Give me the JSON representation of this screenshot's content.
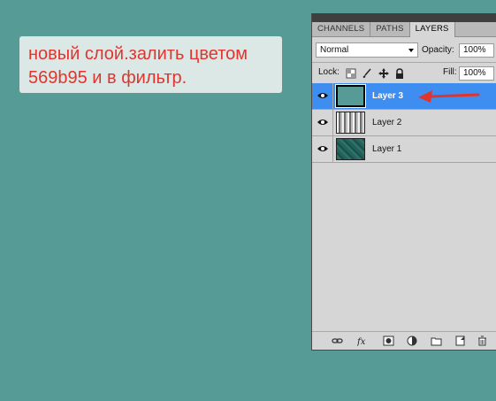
{
  "note": {
    "line1": "новый слой.залить цветом",
    "line2": "569b95 и в фильтр."
  },
  "tabs": [
    {
      "label": "CHANNELS"
    },
    {
      "label": "PATHS"
    },
    {
      "label": "LAYERS"
    }
  ],
  "blend_mode": "Normal",
  "opacity_label": "Opacity:",
  "opacity_value": "100%",
  "lock_label": "Lock:",
  "fill_label": "Fill:",
  "fill_value": "100%",
  "layers": [
    {
      "name": "Layer 3",
      "selected": true
    },
    {
      "name": "Layer 2",
      "selected": false
    },
    {
      "name": "Layer 1",
      "selected": false
    }
  ],
  "colors": {
    "canvas": "#569b95",
    "note_text": "#e0352e",
    "selection": "#3d8ef0"
  }
}
